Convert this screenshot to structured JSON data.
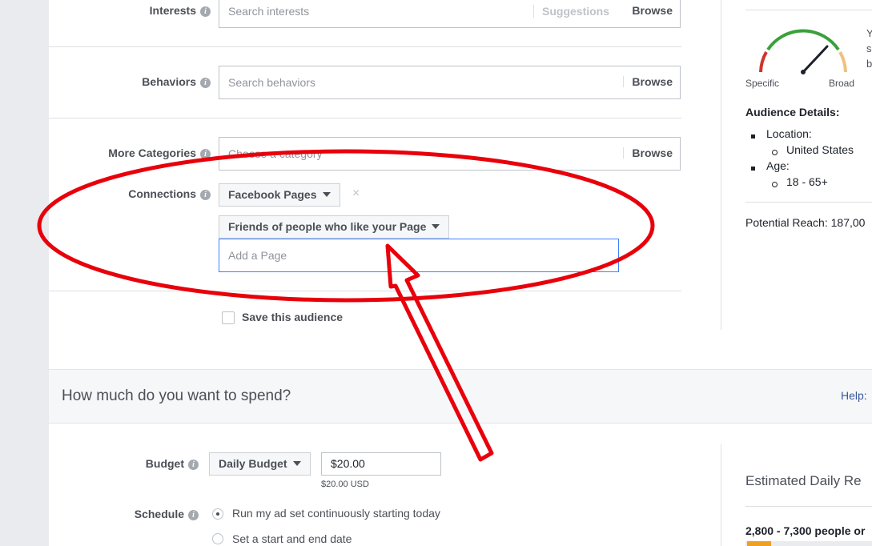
{
  "targeting": {
    "interests": {
      "label": "Interests",
      "placeholder": "Search interests",
      "suggestions": "Suggestions",
      "browse": "Browse"
    },
    "behaviors": {
      "label": "Behaviors",
      "placeholder": "Search behaviors",
      "browse": "Browse"
    },
    "more_categories": {
      "label": "More Categories",
      "placeholder": "Choose a category",
      "browse": "Browse"
    },
    "connections": {
      "label": "Connections",
      "type_selected": "Facebook Pages",
      "remove": "×",
      "option_selected": "Friends of people who like your Page",
      "page_placeholder": "Add a Page"
    },
    "save_audience": "Save this audience"
  },
  "audience_panel": {
    "gauge": {
      "left": "Specific",
      "right": "Broad",
      "side_text": [
        "Y",
        "s",
        "b"
      ]
    },
    "details_title": "Audience Details:",
    "location_label": "Location:",
    "location_value": "United States",
    "age_label": "Age:",
    "age_value": "18 - 65+",
    "potential_reach": "Potential Reach: 187,00"
  },
  "spend": {
    "heading": "How much do you want to spend?",
    "help": "Help:",
    "budget_label": "Budget",
    "budget_type": "Daily Budget",
    "budget_value": "$20.00",
    "budget_note": "$20.00 USD",
    "schedule_label": "Schedule",
    "schedule_option_1": "Run my ad set continuously starting today",
    "schedule_option_2": "Set a start and end date"
  },
  "results_panel": {
    "title": "Estimated Daily Re",
    "range": "2,800 - 7,300 people or"
  },
  "colors": {
    "annotation_red": "#e8000b",
    "gauge_green": "#3aa13a",
    "gauge_red": "#d0342c",
    "gauge_orange": "#f0c080",
    "progress_orange": "#f0a020"
  }
}
